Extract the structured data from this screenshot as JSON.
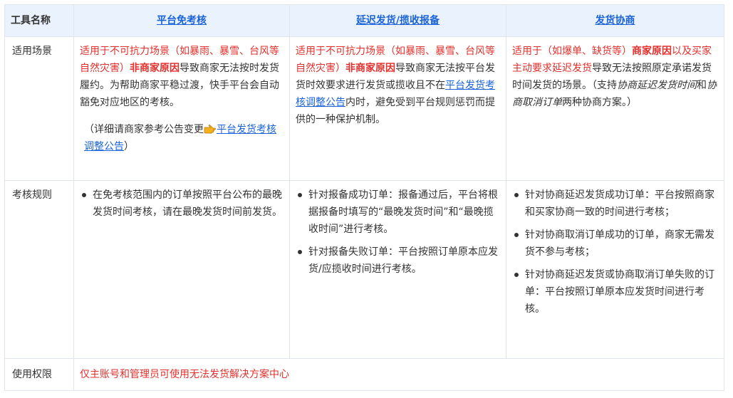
{
  "header": {
    "tool_name": "工具名称",
    "cols": [
      "平台免考核",
      "延迟发货/揽收报备",
      "发货协商"
    ]
  },
  "rows": {
    "scenario": {
      "label": "适用场景",
      "c1": {
        "p1": "适用于不可抗力场景（如暴雨、暴雪、台风等自然灾害）",
        "p1_bold": "非商家原因",
        "p1_tail": "导致商家无法按时发货履约。为帮助商家平稳过渡，快手平台会自动豁免对应地区的考核。",
        "note_pre": "（详细请商家参考公告变更",
        "note_link": "平台发货考核调整公告",
        "note_post": "）",
        "hand_icon": "pointing-hand-icon"
      },
      "c2": {
        "p1": "适用于不可抗力场景（如暴雨、暴雪、台风等自然灾害）",
        "p1_bold": "非商家原因",
        "p1_mid": "导致商家无法按平台发货时效要求进行发货或揽收且不在",
        "p1_link": "平台发货考核调整公告",
        "p1_tail": "内时，避免受到平台规则惩罚而提供的一种保护机制。"
      },
      "c3": {
        "p1": "适用于（如爆单、缺货等）",
        "p1_bold": "商家原因",
        "p1_red2": "以及买家主动要求延迟发货",
        "p1_mid": "导致无法按照原定承诺发货时间发货的场景。（支持",
        "p1_i1": "协商延迟发货时间",
        "p1_and": "和",
        "p1_i2": "协商取消订单",
        "p1_tail": "两种协商方案。）"
      }
    },
    "assessment": {
      "label": "考核规则",
      "c1": [
        "在免考核范围内的订单按照平台公布的最晚发货时间考核，请在最晚发货时间前发货。"
      ],
      "c2": [
        "针对报备成功订单：报备通过后，平台将根据报备时填写的“最晚发货时间”和“最晚揽收时间”进行考核。",
        "针对报备失败订单：平台按照订单原本应发货/应揽收时间进行考核。"
      ],
      "c3": [
        "针对协商延迟发货成功订单：平台按照商家和买家协商一致的时间进行考核；",
        "针对协商取消订单成功的订单，商家无需发货不参与考核；",
        "针对协商延迟发货或协商取消订单失败的订单：平台按照订单原本应发货时间进行考核。"
      ]
    },
    "permission": {
      "label": "使用权限",
      "text": "仅主账号和管理员可使用无法发货解决方案中心"
    }
  },
  "colors": {
    "header_bg": "#eaf2fd",
    "link": "#1a63d8",
    "emphasis": "#e0312e",
    "border": "#e1e6ee"
  }
}
